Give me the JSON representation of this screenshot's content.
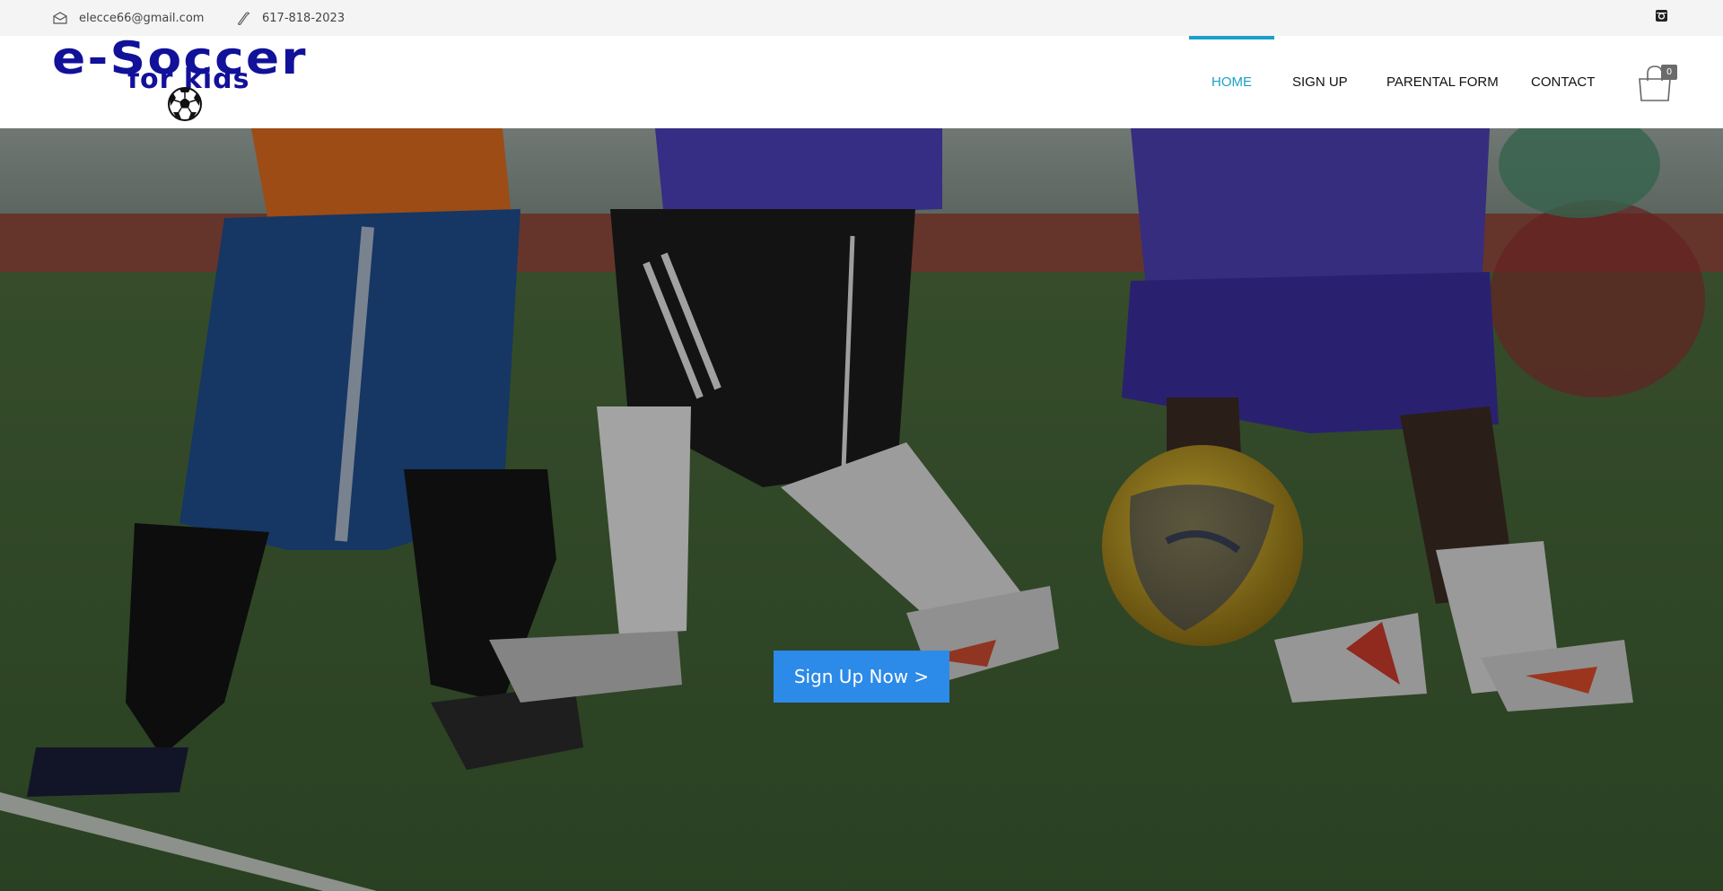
{
  "topbar": {
    "email": "elecce66@gmail.com",
    "phone": "617-818-2023",
    "social_icon": "instagram-icon"
  },
  "logo": {
    "line1": "e-Soccer",
    "line2": "for kids",
    "icon": "soccer-ball-icon"
  },
  "nav": {
    "items": [
      {
        "label": "HOME",
        "active": true
      },
      {
        "label": "SIGN UP",
        "active": false
      },
      {
        "label": "PARENTAL FORM",
        "active": false
      },
      {
        "label": "CONTACT",
        "active": false
      }
    ],
    "cart_icon": "shopping-bag-icon",
    "cart_count": "0"
  },
  "hero": {
    "image": "kids-playing-soccer-photo",
    "cta_label": "Sign Up Now >"
  },
  "colors": {
    "accent": "#1aa0c8",
    "logo": "#11119a",
    "cta": "#2c8ae8",
    "topbar_bg": "#f4f4f4"
  }
}
